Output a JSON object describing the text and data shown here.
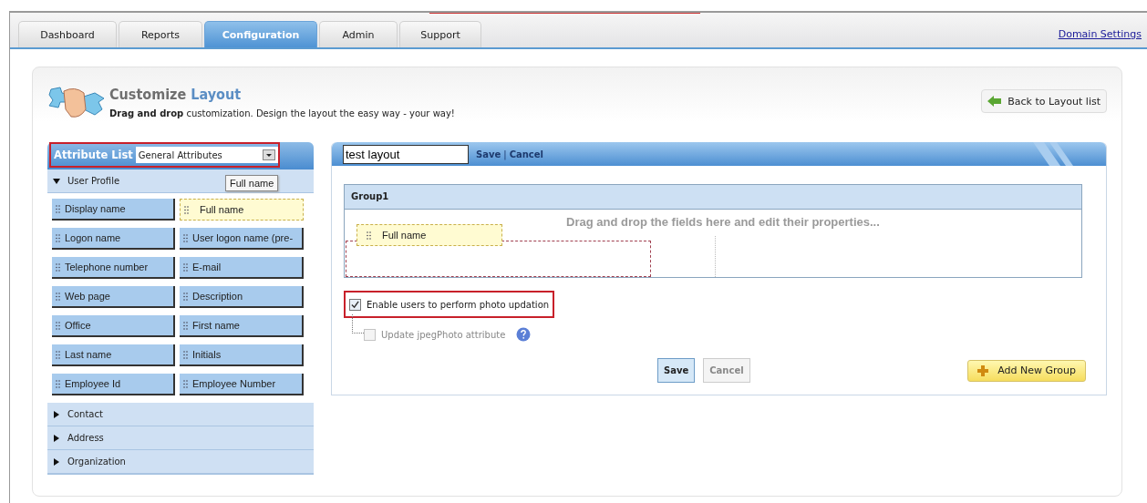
{
  "tabs": [
    {
      "label": "Dashboard",
      "selected": false
    },
    {
      "label": "Reports",
      "selected": false
    },
    {
      "label": "Configuration",
      "selected": true
    },
    {
      "label": "Admin",
      "selected": false
    },
    {
      "label": "Support",
      "selected": false
    }
  ],
  "domain_link": "Domain Settings",
  "header": {
    "title_first": "Customize",
    "title_second": "Layout",
    "subtitle": "**Drag and drop** customization. Design the layout the easy way - your way!",
    "back_button": "Back to Layout list"
  },
  "attribute_list": {
    "title": "Attribute List",
    "dropdown_value": "General Attributes",
    "tooltip": "Full name",
    "sections": [
      {
        "label": "User Profile",
        "expanded": true,
        "fields": [
          {
            "label": "Display name",
            "highlighted": false
          },
          {
            "label": "Full name",
            "highlighted": true
          },
          {
            "label": "Logon name",
            "highlighted": false
          },
          {
            "label": "User logon name (pre-",
            "highlighted": false
          },
          {
            "label": "Telephone number",
            "highlighted": false
          },
          {
            "label": "E-mail",
            "highlighted": false
          },
          {
            "label": "Web page",
            "highlighted": false
          },
          {
            "label": "Description",
            "highlighted": false
          },
          {
            "label": "Office",
            "highlighted": false
          },
          {
            "label": "First name",
            "highlighted": false
          },
          {
            "label": "Last name",
            "highlighted": false
          },
          {
            "label": "Initials",
            "highlighted": false
          },
          {
            "label": "Employee Id",
            "highlighted": false
          },
          {
            "label": "Employee Number",
            "highlighted": false
          }
        ]
      },
      {
        "label": "Contact",
        "expanded": false
      },
      {
        "label": "Address",
        "expanded": false
      },
      {
        "label": "Organization",
        "expanded": false
      }
    ]
  },
  "layout_editor": {
    "name_value": "test layout",
    "save_link": "Save",
    "separator": "|",
    "cancel_link": "Cancel",
    "groups": [
      {
        "title": "Group1",
        "hint": "Drag and drop the fields here and edit their properties...",
        "fields": [
          {
            "label": "Full name"
          }
        ]
      }
    ],
    "options": [
      {
        "label": "Enable users to perform photo updation",
        "checked": true,
        "disabled": false
      },
      {
        "label": "Update jpegPhoto attribute",
        "checked": false,
        "disabled": true
      }
    ],
    "save_button": "Save",
    "cancel_button": "Cancel",
    "add_group_button": "Add New Group"
  }
}
